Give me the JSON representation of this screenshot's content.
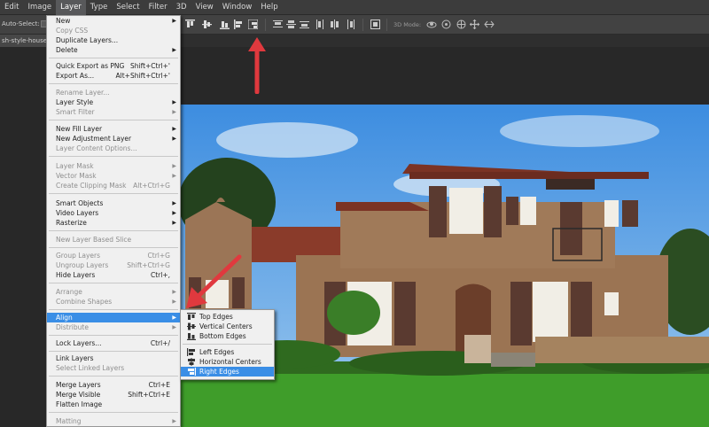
{
  "menubar": {
    "items": [
      {
        "label": "Edit"
      },
      {
        "label": "Image"
      },
      {
        "label": "Layer"
      },
      {
        "label": "Type"
      },
      {
        "label": "Select"
      },
      {
        "label": "Filter"
      },
      {
        "label": "3D"
      },
      {
        "label": "View"
      },
      {
        "label": "Window"
      },
      {
        "label": "Help"
      }
    ],
    "active": "Layer"
  },
  "options": {
    "auto_select_label": "Auto-Select:",
    "mode_3d_label": "3D Mode:"
  },
  "document": {
    "tab_label": "sh-style-house-"
  },
  "layer_menu": {
    "items": [
      {
        "label": "New",
        "shortcut": "",
        "submenu": true,
        "disabled": false
      },
      {
        "label": "Copy CSS",
        "shortcut": "",
        "submenu": false,
        "disabled": true
      },
      {
        "label": "Duplicate Layers...",
        "shortcut": "",
        "submenu": false,
        "disabled": false
      },
      {
        "label": "Delete",
        "shortcut": "",
        "submenu": true,
        "disabled": false
      },
      {
        "label": "Quick Export as PNG",
        "shortcut": "Shift+Ctrl+'",
        "submenu": false,
        "disabled": false
      },
      {
        "label": "Export As...",
        "shortcut": "Alt+Shift+Ctrl+'",
        "submenu": false,
        "disabled": false
      },
      {
        "label": "Rename Layer...",
        "shortcut": "",
        "submenu": false,
        "disabled": true
      },
      {
        "label": "Layer Style",
        "shortcut": "",
        "submenu": true,
        "disabled": false
      },
      {
        "label": "Smart Filter",
        "shortcut": "",
        "submenu": true,
        "disabled": true
      },
      {
        "label": "New Fill Layer",
        "shortcut": "",
        "submenu": true,
        "disabled": false
      },
      {
        "label": "New Adjustment Layer",
        "shortcut": "",
        "submenu": true,
        "disabled": false
      },
      {
        "label": "Layer Content Options...",
        "shortcut": "",
        "submenu": false,
        "disabled": true
      },
      {
        "label": "Layer Mask",
        "shortcut": "",
        "submenu": true,
        "disabled": true
      },
      {
        "label": "Vector Mask",
        "shortcut": "",
        "submenu": true,
        "disabled": true
      },
      {
        "label": "Create Clipping Mask",
        "shortcut": "Alt+Ctrl+G",
        "submenu": false,
        "disabled": true
      },
      {
        "label": "Smart Objects",
        "shortcut": "",
        "submenu": true,
        "disabled": false
      },
      {
        "label": "Video Layers",
        "shortcut": "",
        "submenu": true,
        "disabled": false
      },
      {
        "label": "Rasterize",
        "shortcut": "",
        "submenu": true,
        "disabled": false
      },
      {
        "label": "New Layer Based Slice",
        "shortcut": "",
        "submenu": false,
        "disabled": true
      },
      {
        "label": "Group Layers",
        "shortcut": "Ctrl+G",
        "submenu": false,
        "disabled": true
      },
      {
        "label": "Ungroup Layers",
        "shortcut": "Shift+Ctrl+G",
        "submenu": false,
        "disabled": true
      },
      {
        "label": "Hide Layers",
        "shortcut": "Ctrl+,",
        "submenu": false,
        "disabled": false
      },
      {
        "label": "Arrange",
        "shortcut": "",
        "submenu": true,
        "disabled": true
      },
      {
        "label": "Combine Shapes",
        "shortcut": "",
        "submenu": true,
        "disabled": true
      },
      {
        "label": "Align",
        "shortcut": "",
        "submenu": true,
        "disabled": false,
        "highlighted": true
      },
      {
        "label": "Distribute",
        "shortcut": "",
        "submenu": true,
        "disabled": true
      },
      {
        "label": "Lock Layers...",
        "shortcut": "Ctrl+/",
        "submenu": false,
        "disabled": false
      },
      {
        "label": "Link Layers",
        "shortcut": "",
        "submenu": false,
        "disabled": false
      },
      {
        "label": "Select Linked Layers",
        "shortcut": "",
        "submenu": false,
        "disabled": true
      },
      {
        "label": "Merge Layers",
        "shortcut": "Ctrl+E",
        "submenu": false,
        "disabled": false
      },
      {
        "label": "Merge Visible",
        "shortcut": "Shift+Ctrl+E",
        "submenu": false,
        "disabled": false
      },
      {
        "label": "Flatten Image",
        "shortcut": "",
        "submenu": false,
        "disabled": false
      },
      {
        "label": "Matting",
        "shortcut": "",
        "submenu": true,
        "disabled": true
      }
    ]
  },
  "align_submenu": {
    "items": [
      {
        "label": "Top Edges",
        "icon": "align-top-edges-icon"
      },
      {
        "label": "Vertical Centers",
        "icon": "align-vertical-centers-icon"
      },
      {
        "label": "Bottom Edges",
        "icon": "align-bottom-edges-icon"
      },
      {
        "label": "Left Edges",
        "icon": "align-left-edges-icon"
      },
      {
        "label": "Horizontal Centers",
        "icon": "align-horizontal-centers-icon"
      },
      {
        "label": "Right Edges",
        "icon": "align-right-edges-icon",
        "highlighted": true
      }
    ]
  },
  "colors": {
    "highlight": "#3a8ee6",
    "annotation_arrow": "#e0393e"
  }
}
